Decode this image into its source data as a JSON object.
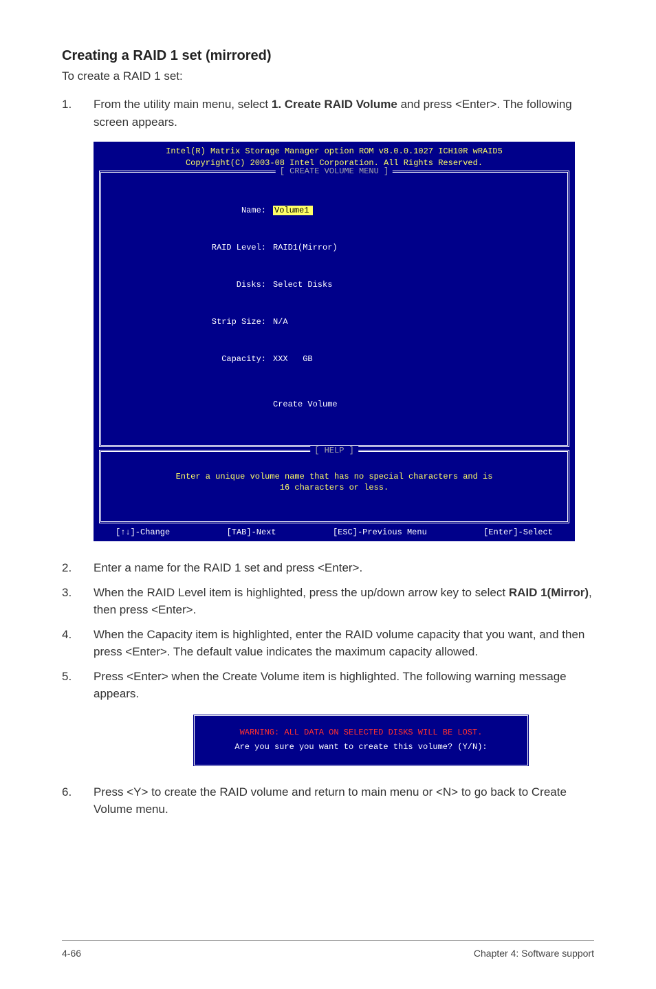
{
  "heading": "Creating a RAID 1 set (mirrored)",
  "intro": "To create a RAID 1 set:",
  "step1": {
    "num": "1.",
    "pre": "From the utility main menu, select ",
    "bold": "1. Create RAID Volume",
    "post": " and press <Enter>. The following screen appears."
  },
  "bios": {
    "header_line1": "Intel(R) Matrix Storage Manager option ROM v8.0.0.1027 ICH10R wRAID5",
    "header_line2": "Copyright(C) 2003-08 Intel Corporation. All Rights Reserved.",
    "create_menu_title": "[ CREATE VOLUME MENU ]",
    "fields": {
      "name_label": "Name:",
      "name_value": "Volume1",
      "raid_label": "RAID Level:",
      "raid_value": "RAID1(Mirror)",
      "disks_label": "Disks:",
      "disks_value": "Select Disks",
      "strip_label": "Strip Size:",
      "strip_value": "N/A",
      "capacity_label": "Capacity:",
      "capacity_value": "XXX   GB",
      "create": "Create Volume"
    },
    "help_title": "[ HELP ]",
    "help_text": "Enter a unique volume name that has no special characters and is\n16 characters or less.",
    "footer": {
      "change": "[↑↓]-Change",
      "next": "[TAB]-Next",
      "prev": "[ESC]-Previous Menu",
      "select": "[Enter]-Select"
    }
  },
  "step2": {
    "num": "2.",
    "text": "Enter a name for the RAID 1 set and press <Enter>."
  },
  "step3": {
    "num": "3.",
    "pre": "When the RAID Level item is highlighted, press the up/down arrow key to select ",
    "bold": "RAID 1(Mirror)",
    "post": ", then press <Enter>."
  },
  "step4": {
    "num": "4.",
    "text": "When the Capacity item is highlighted, enter the RAID volume capacity that you want, and then press <Enter>. The default value indicates the maximum capacity allowed."
  },
  "step5": {
    "num": "5.",
    "text": "Press <Enter> when the Create Volume item is highlighted. The following warning message appears."
  },
  "warning": {
    "line1": "WARNING: ALL DATA ON SELECTED DISKS WILL BE LOST.",
    "line2": "Are you sure you want to create this volume? (Y/N):"
  },
  "step6": {
    "num": "6.",
    "text": "Press <Y> to create the RAID volume and return to main menu or <N> to go back to Create Volume menu."
  },
  "footer": {
    "left": "4-66",
    "right": "Chapter 4: Software support"
  }
}
